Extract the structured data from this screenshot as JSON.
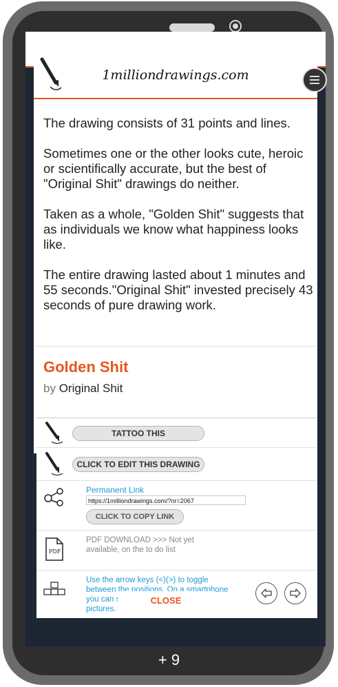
{
  "site": {
    "title": "1milliondrawings.com"
  },
  "description": {
    "paragraphs": [
      "The drawing consists of 31 points and lines.",
      "Sometimes one or the other looks cute, heroic or scientifically accurate, but the best of \"Original Shit\" drawings do neither.",
      "Taken as a whole, \"Golden Shit\" suggests that as individuals we know what happiness looks like.",
      "The entire drawing lasted about 1 minutes and 55 seconds.\"Original Shit\" invested precisely 43 seconds of pure drawing work."
    ]
  },
  "drawing": {
    "title": "Golden Shit",
    "by_label": "by",
    "author": "Original Shit",
    "dash": "-"
  },
  "actions": {
    "tattoo_label": "TATTOO THIS",
    "edit_label": "CLICK TO EDIT THIS DRAWING",
    "permanent_link_label": "Permanent Link",
    "permanent_link_url": "https://1milliondrawings.com/?nr=2067",
    "copy_link_label": "CLICK TO COPY LINK",
    "pdf_text": "PDF DOWNLOAD >>> Not yet available, on the to do list",
    "navigation_hint": "Use the arrow keys (<)(>) to toggle between the positions. On a smartphone you can swipe the bottom half of the pictures.",
    "close_label": "CLOSE"
  },
  "counter": "+ 9",
  "colors": {
    "accent": "#e4581f",
    "link": "#1e9ad6",
    "frame": "#6b6b6b",
    "screen_bg": "#1d2733"
  },
  "icons": [
    "pen-icon",
    "menu-icon",
    "share-link-icon",
    "pdf-icon",
    "keyboard-arrows-icon",
    "arrow-left-icon",
    "arrow-right-icon"
  ]
}
